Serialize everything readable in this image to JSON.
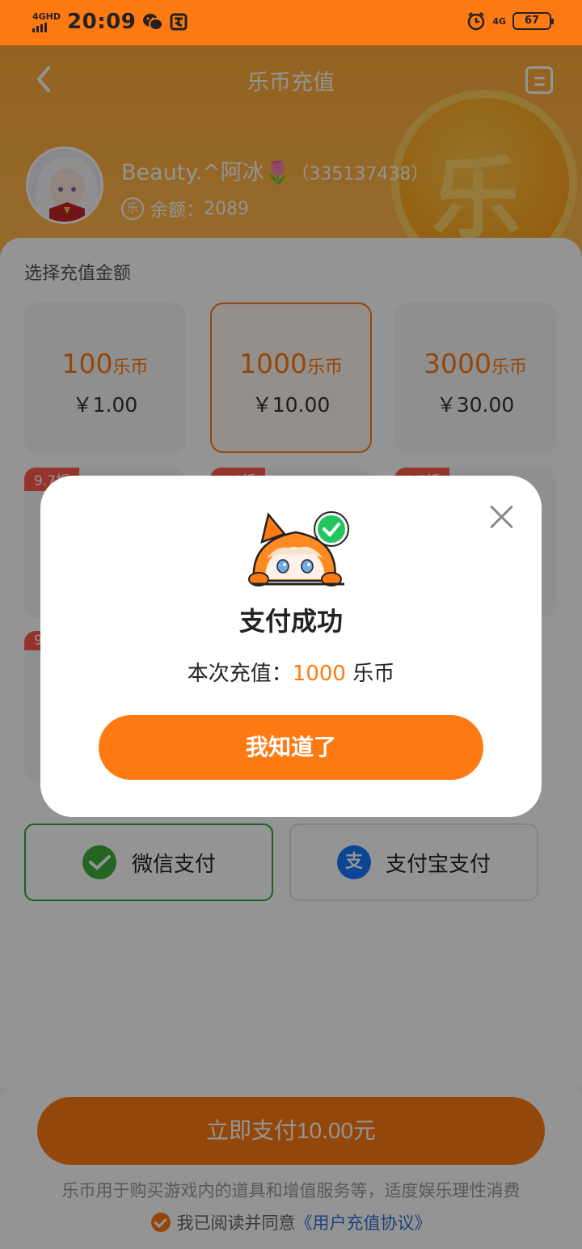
{
  "status_bar": {
    "network": "4GHD",
    "time": "20:09",
    "network_right": "4G",
    "battery": "67"
  },
  "header": {
    "title": "乐币充值",
    "coin_char": "乐"
  },
  "user": {
    "name": "Beauty.^阿冰🌷",
    "id": "（335137438）",
    "balance_label": "余额：",
    "balance": "2089",
    "coin_badge": "乐"
  },
  "amounts": {
    "section_label": "选择充值金额",
    "unit": "乐币",
    "cards": [
      {
        "coins": "100",
        "price": "￥1.00",
        "selected": false
      },
      {
        "coins": "1000",
        "price": "￥10.00",
        "selected": true
      },
      {
        "coins": "3000",
        "price": "￥30.00",
        "selected": false
      }
    ],
    "discount_tags": [
      "9.7折",
      "9.6折",
      "9.5折",
      "9"
    ]
  },
  "payment": {
    "wechat": {
      "label": "微信支付",
      "icon": "wechat-pay-icon",
      "color": "#3fae3a"
    },
    "alipay": {
      "label": "支付宝支付",
      "icon": "alipay-icon",
      "glyph": "支",
      "color": "#1677ff"
    }
  },
  "bottom": {
    "pay_button": "立即支付10.00元",
    "tip": "乐币用于购买游戏内的道具和增值服务等，适度娱乐理性消费",
    "agree_text": "我已阅读并同意",
    "agree_link": "《用户充值协议》"
  },
  "dialog": {
    "title": "支付成功",
    "line_prefix": "本次充值：",
    "amount": "1000",
    "line_suffix": " 乐币",
    "confirm": "我知道了"
  },
  "colors": {
    "accent": "#ff7a13",
    "success": "#2ea73c",
    "link": "#2f6fd6"
  }
}
